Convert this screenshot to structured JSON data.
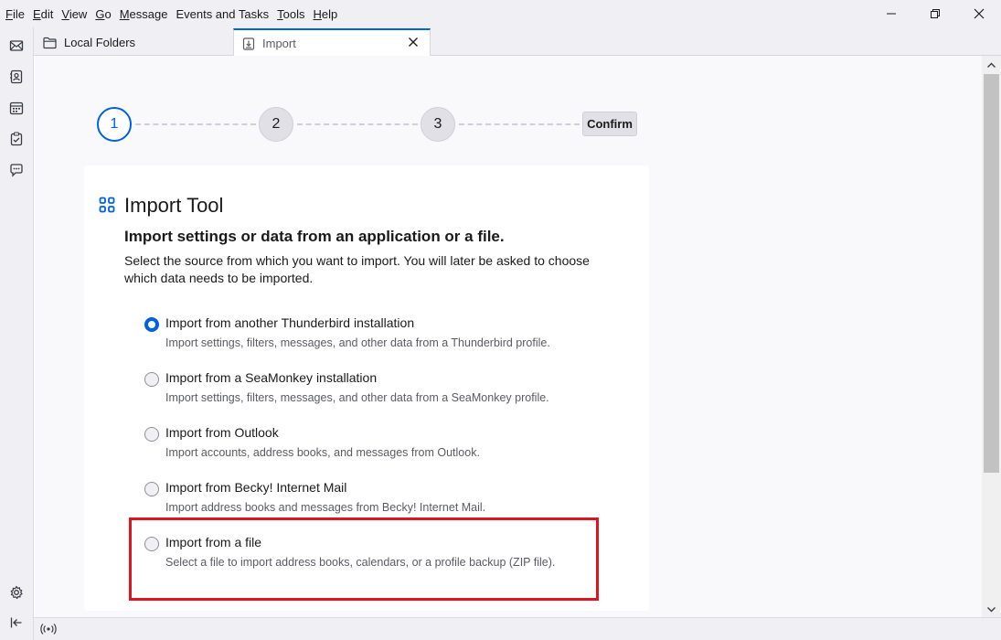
{
  "menubar": {
    "items": [
      {
        "key": "F",
        "rest": "ile"
      },
      {
        "key": "E",
        "rest": "dit"
      },
      {
        "key": "V",
        "rest": "iew"
      },
      {
        "key": "G",
        "rest": "o"
      },
      {
        "key": "M",
        "rest": "essage"
      },
      {
        "key": "",
        "rest": "Events and Tasks"
      },
      {
        "key": "T",
        "rest": "ools"
      },
      {
        "key": "H",
        "rest": "elp"
      }
    ]
  },
  "tabs": {
    "local_folders": "Local Folders",
    "import": "Import"
  },
  "steps": {
    "one": "1",
    "two": "2",
    "three": "3",
    "confirm": "Confirm"
  },
  "card": {
    "title": "Import Tool",
    "subtitle": "Import settings or data from an application or a file.",
    "description": "Select the source from which you want to import. You will later be asked to choose which data needs to be imported."
  },
  "options": [
    {
      "label": "Import from another Thunderbird installation",
      "desc": "Import settings, filters, messages, and other data from a Thunderbird profile.",
      "checked": true
    },
    {
      "label": "Import from a SeaMonkey installation",
      "desc": "Import settings, filters, messages, and other data from a SeaMonkey profile.",
      "checked": false
    },
    {
      "label": "Import from Outlook",
      "desc": "Import accounts, address books, and messages from Outlook.",
      "checked": false
    },
    {
      "label": "Import from Becky! Internet Mail",
      "desc": "Import address books and messages from Becky! Internet Mail.",
      "checked": false
    },
    {
      "label": "Import from a file",
      "desc": "Select a file to import address books, calendars, or a profile backup (ZIP file).",
      "checked": false
    }
  ],
  "colors": {
    "accent": "#0061e0",
    "highlight": "#e0141e"
  },
  "icons": {
    "spaces": [
      "mail-icon",
      "address-book-icon",
      "calendar-icon",
      "tasks-icon",
      "chat-icon"
    ],
    "bottom": [
      "settings-icon",
      "collapse-sidebar-icon"
    ],
    "status": "online-status-icon"
  }
}
